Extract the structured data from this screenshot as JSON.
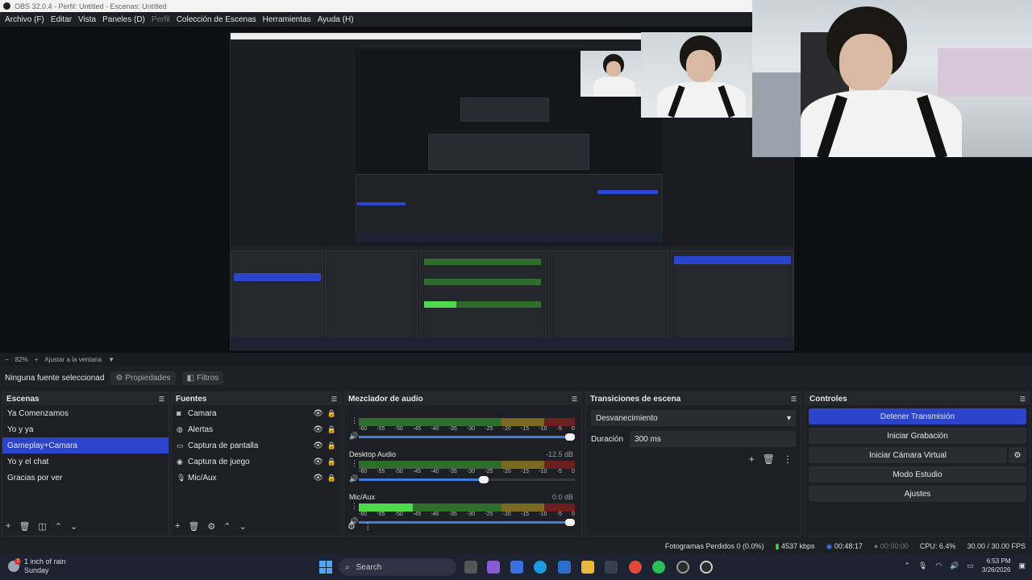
{
  "window": {
    "title": "OBS 32.0.4 - Perfil: Untitled - Escenas: Untitled"
  },
  "menu": [
    "Archivo (F)",
    "Editar",
    "Vista",
    "Paneles (D)",
    "Perfil",
    "Colección de Escenas",
    "Herramientas",
    "Ayuda (H)"
  ],
  "zoom": {
    "level": "82%",
    "fit": "Ajustar a la ventana"
  },
  "source_toolbar": {
    "none_selected": "Ninguna fuente seleccionad",
    "properties": "Propiedades",
    "filters": "Filtros"
  },
  "scenes": {
    "title": "Escenas",
    "items": [
      "Ya Comenzamos",
      "Yo y ya",
      "Gameplay+Camara",
      "Yo y el chat",
      "Gracias por ver"
    ],
    "selected_index": 2
  },
  "sources": {
    "title": "Fuentes",
    "items": [
      {
        "name": "Camara",
        "icon": "camera-icon"
      },
      {
        "name": "Alertas",
        "icon": "globe-icon"
      },
      {
        "name": "Captura de pantalla",
        "icon": "monitor-icon"
      },
      {
        "name": "Captura de juego",
        "icon": "gamepad-icon"
      },
      {
        "name": "Mic/Aux",
        "icon": "microphone-icon"
      }
    ]
  },
  "mixer": {
    "title": "Mezclador de audio",
    "ticks": [
      "-60",
      "-55",
      "-50",
      "-45",
      "-40",
      "-35",
      "-30",
      "-25",
      "-20",
      "-15",
      "-10",
      "-5",
      "0"
    ],
    "channels": [
      {
        "name": "",
        "db": "",
        "level": 0.0,
        "volume": 1.0
      },
      {
        "name": "Desktop Audio",
        "db": "-12.5 dB",
        "level": 0.0,
        "volume": 0.6
      },
      {
        "name": "Mic/Aux",
        "db": "0.0 dB",
        "level": 0.25,
        "volume": 1.0
      }
    ]
  },
  "transitions": {
    "title": "Transiciones de escena",
    "selected": "Desvanecimiento",
    "duration_label": "Duración",
    "duration_value": "300 ms"
  },
  "controls": {
    "title": "Controles",
    "stop_stream": "Detener Transmisión",
    "start_record": "Iniciar Grabación",
    "virtual_cam": "Iniciar Cámara Virtual",
    "studio_mode": "Modo Estudio",
    "settings": "Ajustes"
  },
  "status": {
    "dropped": "Fotogramas Perdidos 0 (0.0%)",
    "bitrate": "4537 kbps",
    "stream_time": "00:48:17",
    "record_time": "00:00:00",
    "cpu": "CPU: 6.4%",
    "fps": "30.00 / 30.00 FPS"
  },
  "taskbar": {
    "weather_title": "1 inch of rain",
    "weather_sub": "Sunday",
    "weather_badge": "2",
    "search_placeholder": "Search",
    "time": "6:53 PM",
    "date": "3/26/2026"
  },
  "colors": {
    "accent": "#2c44c9",
    "background": "#1e1f24"
  }
}
